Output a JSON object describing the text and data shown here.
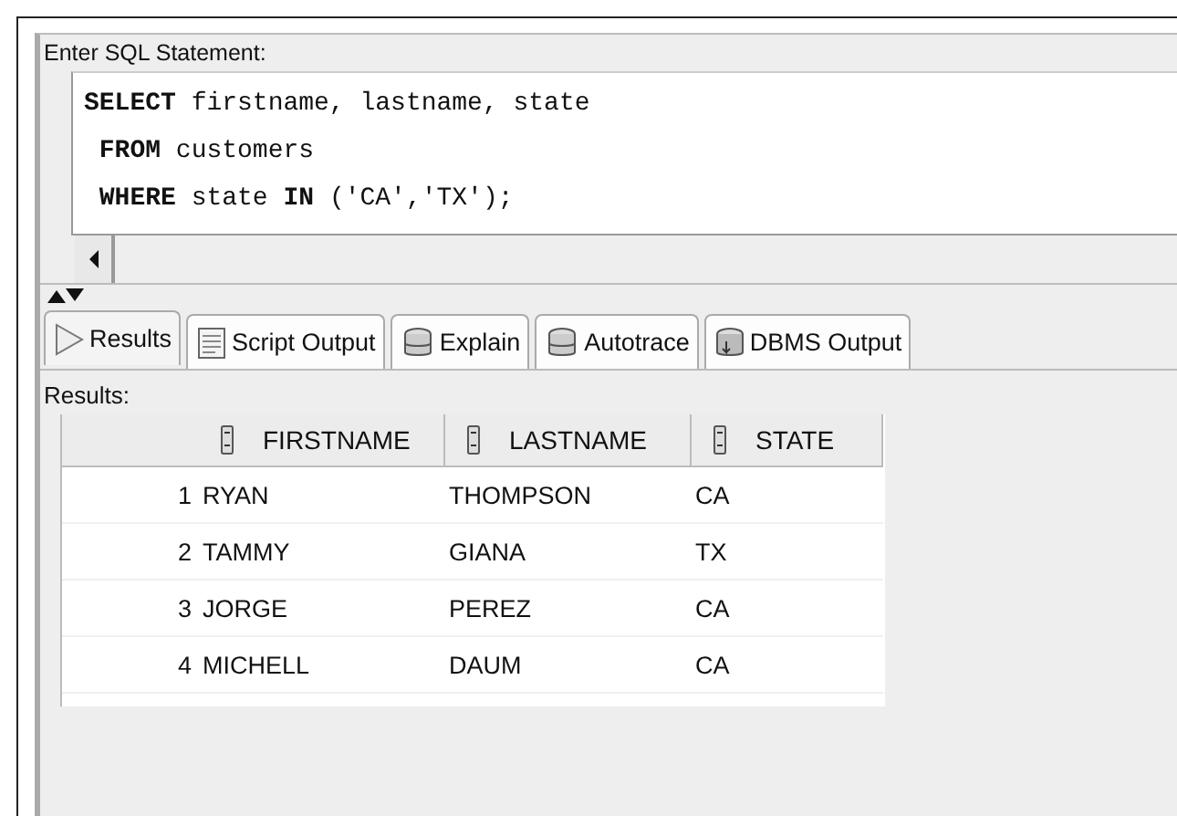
{
  "editor": {
    "label": "Enter SQL Statement:",
    "lines": [
      "**SELECT** firstname, lastname, state",
      " **FROM** customers",
      " **WHERE** state **IN** ('CA','TX');"
    ]
  },
  "tabs": [
    {
      "label": "Results",
      "selected": true
    },
    {
      "label": "Script Output",
      "selected": false
    },
    {
      "label": "Explain",
      "selected": false
    },
    {
      "label": "Autotrace",
      "selected": false
    },
    {
      "label": "DBMS Output",
      "selected": false
    }
  ],
  "results": {
    "label": "Results:",
    "columns": [
      "FIRSTNAME",
      "LASTNAME",
      "STATE"
    ],
    "rows": [
      {
        "number": "1",
        "cells": [
          "RYAN",
          "THOMPSON",
          "CA"
        ]
      },
      {
        "number": "2",
        "cells": [
          "TAMMY",
          "GIANA",
          "TX"
        ]
      },
      {
        "number": "3",
        "cells": [
          "JORGE",
          "PEREZ",
          "CA"
        ]
      },
      {
        "number": "4",
        "cells": [
          "MICHELL",
          "DAUM",
          "CA"
        ]
      }
    ]
  }
}
